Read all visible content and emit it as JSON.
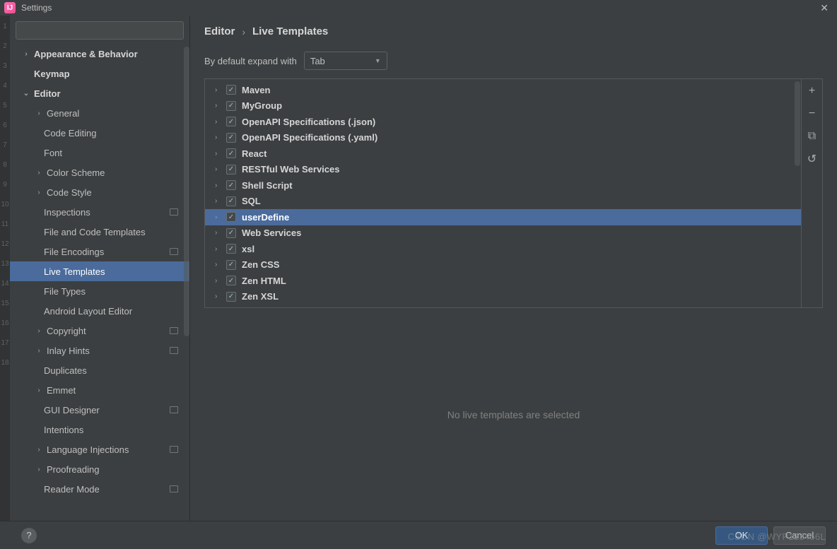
{
  "window": {
    "title": "Settings",
    "close_glyph": "✕"
  },
  "search": {
    "placeholder": "",
    "icon": "search-icon"
  },
  "sidebar": {
    "items": [
      {
        "label": "Appearance & Behavior",
        "bold": true,
        "chevron": true,
        "indent": 0
      },
      {
        "label": "Keymap",
        "bold": true,
        "indent": 0
      },
      {
        "label": "Editor",
        "bold": true,
        "chevron": true,
        "expanded": true,
        "indent": 0
      },
      {
        "label": "General",
        "chevron": true,
        "indent": 1
      },
      {
        "label": "Code Editing",
        "indent": 2
      },
      {
        "label": "Font",
        "indent": 2
      },
      {
        "label": "Color Scheme",
        "chevron": true,
        "indent": 1
      },
      {
        "label": "Code Style",
        "chevron": true,
        "indent": 1
      },
      {
        "label": "Inspections",
        "indent": 2,
        "badge": true
      },
      {
        "label": "File and Code Templates",
        "indent": 2
      },
      {
        "label": "File Encodings",
        "indent": 2,
        "badge": true
      },
      {
        "label": "Live Templates",
        "indent": 2,
        "selected": true
      },
      {
        "label": "File Types",
        "indent": 2
      },
      {
        "label": "Android Layout Editor",
        "indent": 2
      },
      {
        "label": "Copyright",
        "chevron": true,
        "indent": 1,
        "badge": true
      },
      {
        "label": "Inlay Hints",
        "chevron": true,
        "indent": 1,
        "badge": true
      },
      {
        "label": "Duplicates",
        "indent": 2
      },
      {
        "label": "Emmet",
        "chevron": true,
        "indent": 1
      },
      {
        "label": "GUI Designer",
        "indent": 2,
        "badge": true
      },
      {
        "label": "Intentions",
        "indent": 2
      },
      {
        "label": "Language Injections",
        "chevron": true,
        "indent": 1,
        "badge": true
      },
      {
        "label": "Proofreading",
        "chevron": true,
        "indent": 1
      },
      {
        "label": "Reader Mode",
        "indent": 2,
        "badge": true
      }
    ]
  },
  "breadcrumb": {
    "root": "Editor",
    "sep": "›",
    "leaf": "Live Templates"
  },
  "expand": {
    "label": "By default expand with",
    "value": "Tab"
  },
  "templates": [
    {
      "name": "Maven",
      "checked": true
    },
    {
      "name": "MyGroup",
      "checked": true
    },
    {
      "name": "OpenAPI Specifications (.json)",
      "checked": true
    },
    {
      "name": "OpenAPI Specifications (.yaml)",
      "checked": true
    },
    {
      "name": "React",
      "checked": true
    },
    {
      "name": "RESTful Web Services",
      "checked": true
    },
    {
      "name": "Shell Script",
      "checked": true
    },
    {
      "name": "SQL",
      "checked": true
    },
    {
      "name": "userDefine",
      "checked": true,
      "selected": true
    },
    {
      "name": "Web Services",
      "checked": true
    },
    {
      "name": "xsl",
      "checked": true
    },
    {
      "name": "Zen CSS",
      "checked": true
    },
    {
      "name": "Zen HTML",
      "checked": true
    },
    {
      "name": "Zen XSL",
      "checked": true
    }
  ],
  "tools": {
    "add": "+",
    "remove": "−",
    "copy": "⧉",
    "revert": "↺"
  },
  "empty_message": "No live templates are selected",
  "footer": {
    "ok": "OK",
    "cancel": "Cancel",
    "help": "?"
  },
  "watermark": "CSDN @WYP123456L"
}
